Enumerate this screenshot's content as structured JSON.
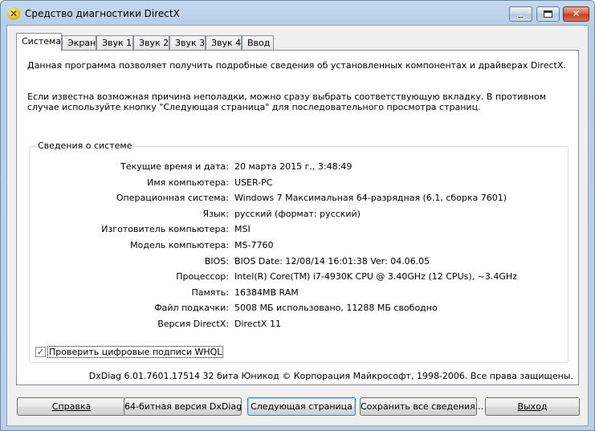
{
  "window": {
    "title": "Средство диагностики DirectX",
    "close_glyph": "✕",
    "icon": "directx-icon"
  },
  "tabs": [
    {
      "label": "Система",
      "active": true
    },
    {
      "label": "Экран"
    },
    {
      "label": "Звук 1"
    },
    {
      "label": "Звук 2"
    },
    {
      "label": "Звук 3"
    },
    {
      "label": "Звук 4"
    },
    {
      "label": "Ввод"
    }
  ],
  "intro": {
    "line1": "Данная программа позволяет получить подробные сведения об установленных компонентах и драйверах DirectX.",
    "line2": "Если известна возможная причина неполадки, можно сразу выбрать соответствующую вкладку. В противном случае используйте кнопку \"Следующая страница\" для последовательного просмотра страниц."
  },
  "system_info": {
    "legend": "Сведения о системе",
    "rows": [
      {
        "label": "Текущие время и дата:",
        "value": "20 марта 2015 г., 3:48:49"
      },
      {
        "label": "Имя компьютера:",
        "value": "USER-PC"
      },
      {
        "label": "Операционная система:",
        "value": "Windows 7 Максимальная 64-разрядная (6.1, сборка 7601)"
      },
      {
        "label": "Язык:",
        "value": "русский (формат: русский)"
      },
      {
        "label": "Изготовитель компьютера:",
        "value": "MSI"
      },
      {
        "label": "Модель компьютера:",
        "value": "MS-7760"
      },
      {
        "label": "BIOS:",
        "value": "BIOS Date: 12/08/14 16:01:38 Ver: 04.06.05"
      },
      {
        "label": "Процессор:",
        "value": "Intel(R) Core(TM) i7-4930K CPU @ 3.40GHz (12 CPUs), ~3.4GHz"
      },
      {
        "label": "Память:",
        "value": "16384MB RAM"
      },
      {
        "label": "Файл подкачки:",
        "value": "5008 МБ использовано, 11288 МБ свободно"
      },
      {
        "label": "Версия DirectX:",
        "value": "DirectX 11"
      }
    ],
    "whql_checkbox": {
      "label": "Проверить цифровые подписи WHQL",
      "checked": true,
      "check_glyph": "✓"
    }
  },
  "copyright": "DxDiag 6.01.7601.17514 32 бита Юникод  © Корпорация Майкрософт, 1998-2006.  Все права защищены.",
  "buttons": {
    "help": "Справка",
    "dxdiag64": "64-битная версия DxDiag",
    "next_page": "Следующая страница",
    "save_all": "Сохранить все сведения...",
    "exit": "Выход"
  }
}
